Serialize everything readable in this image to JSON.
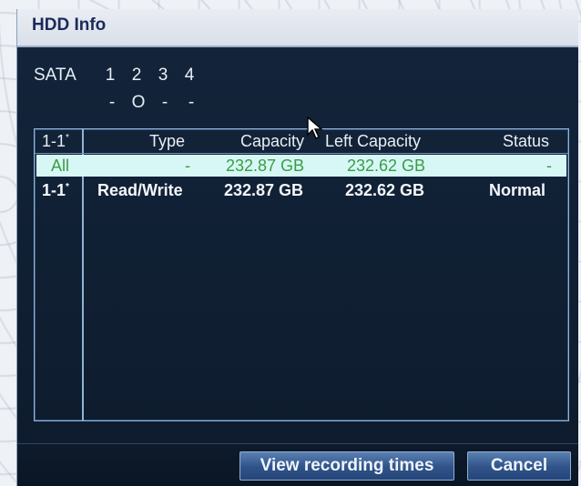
{
  "window": {
    "title": "HDD Info"
  },
  "sata": {
    "label": "SATA",
    "ports": [
      {
        "number": "1",
        "status": "-"
      },
      {
        "number": "2",
        "status": "O"
      },
      {
        "number": "3",
        "status": "-"
      },
      {
        "number": "4",
        "status": "-"
      }
    ]
  },
  "table": {
    "headers": {
      "id": "1-1",
      "id_mark": "*",
      "type": "Type",
      "capacity": "Capacity",
      "left_capacity": "Left Capacity",
      "status": "Status"
    },
    "rows": [
      {
        "id": "All",
        "id_mark": "",
        "type": "-",
        "capacity": "232.87 GB",
        "left_capacity": "232.62 GB",
        "status": "-",
        "selected": true
      },
      {
        "id": "1-1",
        "id_mark": "*",
        "type": "Read/Write",
        "capacity": "232.87 GB",
        "left_capacity": "232.62 GB",
        "status": "Normal",
        "selected": false
      }
    ]
  },
  "buttons": {
    "view_recording_times": "View recording times",
    "cancel": "Cancel"
  },
  "icons": {
    "cursor": "mouse-pointer-icon"
  },
  "colors": {
    "selected_row_bg": "#d7f7f7",
    "selected_row_text": "#3a9d43",
    "button": "#2f5389",
    "panel": "#0f1f33"
  }
}
